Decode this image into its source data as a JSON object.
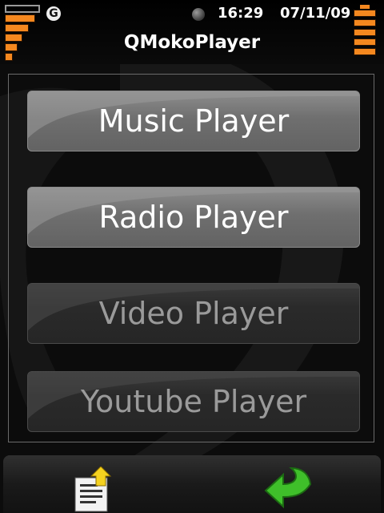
{
  "status": {
    "network_label": "G",
    "time": "16:29",
    "date": "07/11/09"
  },
  "app": {
    "title": "QMokoPlayer"
  },
  "menu": {
    "items": [
      {
        "label": "Music Player",
        "enabled": true
      },
      {
        "label": "Radio Player",
        "enabled": true
      },
      {
        "label": "Video Player",
        "enabled": false
      },
      {
        "label": "Youtube Player",
        "enabled": false
      }
    ]
  },
  "toolbar": {
    "left_icon": "document-upload-icon",
    "right_icon": "back-arrow-icon"
  },
  "colors": {
    "accent": "#f5881f",
    "back_arrow": "#3fbf2a"
  }
}
